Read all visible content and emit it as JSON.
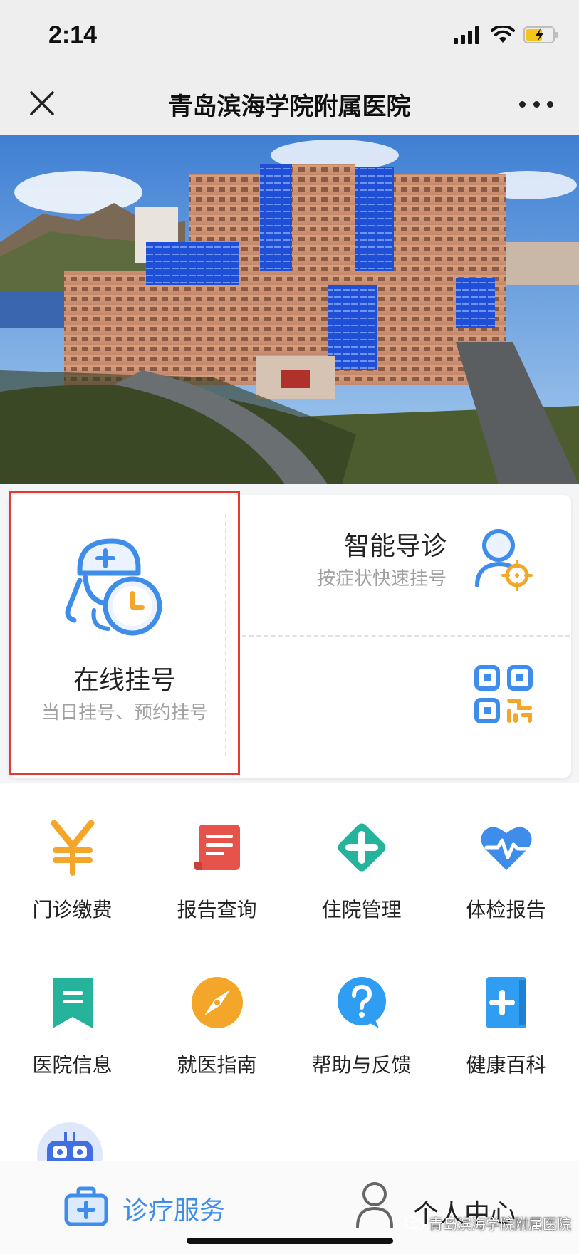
{
  "status_bar": {
    "time": "2:14"
  },
  "nav": {
    "title": "青岛滨海学院附属医院"
  },
  "hero": {
    "image_alt": "hospital-building-photo"
  },
  "features": {
    "online_registration": {
      "title": "在线挂号",
      "subtitle": "当日挂号、预约挂号",
      "icon": "doctor-clock-icon"
    },
    "smart_triage": {
      "title": "智能导诊",
      "subtitle": "按症状快速挂号",
      "icon": "person-target-icon"
    },
    "scan": {
      "icon": "qr-code-icon"
    }
  },
  "grid": [
    {
      "label": "门诊缴费",
      "icon": "yuan-icon",
      "color": "#f4a62a"
    },
    {
      "label": "报告查询",
      "icon": "report-icon",
      "color": "#e5534b"
    },
    {
      "label": "住院管理",
      "icon": "medical-cross-icon",
      "color": "#26b39b"
    },
    {
      "label": "体检报告",
      "icon": "heart-pulse-icon",
      "color": "#3f8dea"
    },
    {
      "label": "医院信息",
      "icon": "bookmark-icon",
      "color": "#26b39b"
    },
    {
      "label": "就医指南",
      "icon": "compass-icon",
      "color": "#f4a62a"
    },
    {
      "label": "帮助与反馈",
      "icon": "question-icon",
      "color": "#2f9df2"
    },
    {
      "label": "健康百科",
      "icon": "book-plus-icon",
      "color": "#2f9df2"
    }
  ],
  "tab_bar": {
    "service_label": "诊疗服务",
    "user_label": "个人中心",
    "active_color": "#3f8dea"
  },
  "watermark": "青岛滨海学院附属医院"
}
